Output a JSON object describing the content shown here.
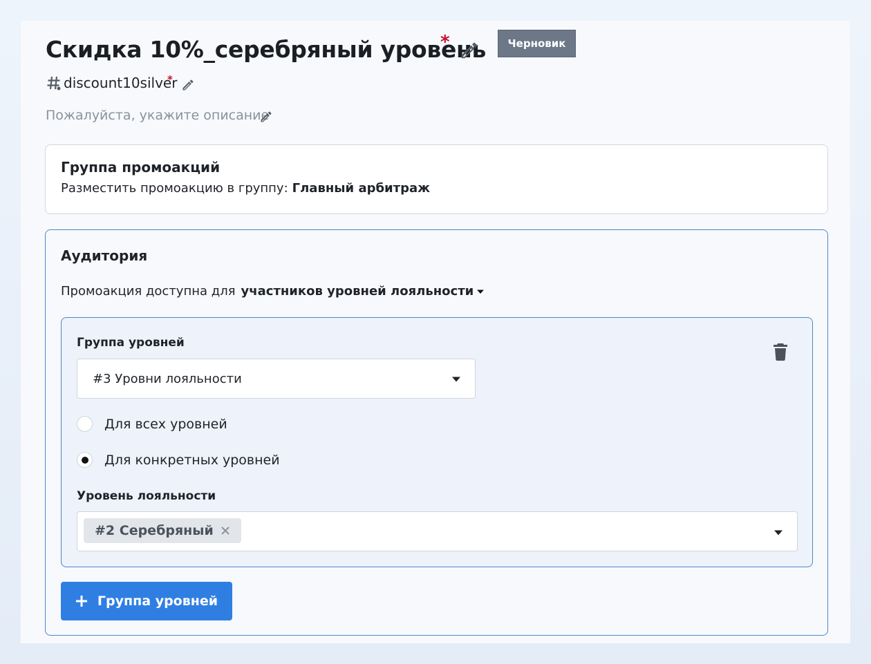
{
  "header": {
    "title": "Скидка 10%_серебряный уровень",
    "required_mark": "*",
    "status_badge": "Черновик",
    "code": "discount10silver",
    "description_placeholder": "Пожалуйста, укажите описание"
  },
  "promo_group": {
    "title": "Группа промоакций",
    "label": "Разместить промоакцию в группу:",
    "value": "Главный арбитраж"
  },
  "audience": {
    "title": "Аудитория",
    "available_label": "Промоакция доступна для",
    "available_value": "участников уровней лояльности",
    "level_group": {
      "label": "Группа уровней",
      "selected": "#3 Уровни лояльности",
      "radio_all": "Для всех уровней",
      "radio_specific": "Для конкретных уровней",
      "selected_radio": "specific",
      "loyalty_level_label": "Уровень лояльности",
      "chips": [
        "#2 Серебряный"
      ]
    },
    "add_button": "Группа уровней"
  },
  "colors": {
    "accent": "#2f7fe3",
    "border_active": "#4a87c8",
    "badge": "#6c7788",
    "required": "#c8102e"
  }
}
